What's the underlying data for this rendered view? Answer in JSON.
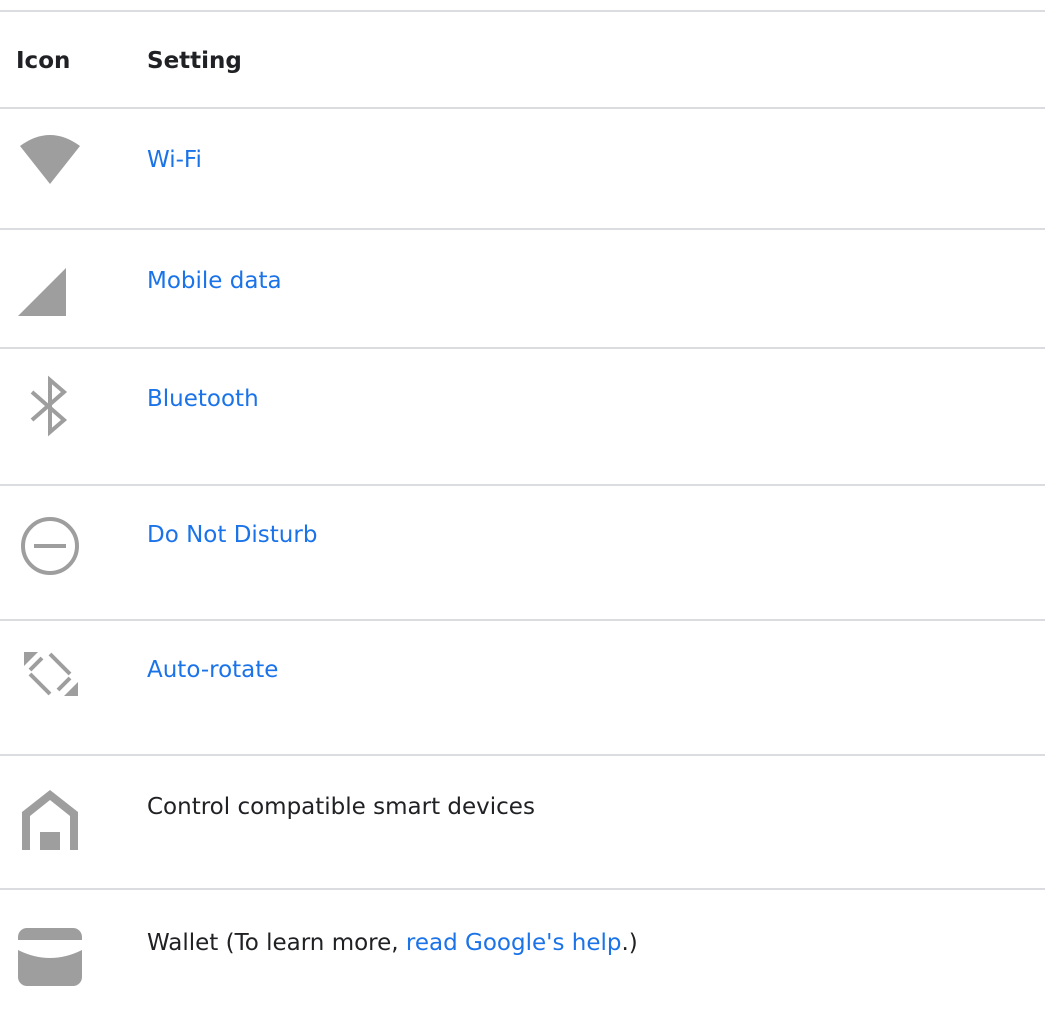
{
  "header": {
    "icon_col": "Icon",
    "setting_col": "Setting"
  },
  "colors": {
    "link": "#1a73e8",
    "text": "#202124",
    "icon": "#9e9e9e",
    "rule": "#dadce0"
  },
  "rows": [
    {
      "icon": "wifi-icon",
      "label": "Wi-Fi",
      "is_link": true
    },
    {
      "icon": "mobile-signal-icon",
      "label": "Mobile data",
      "is_link": true
    },
    {
      "icon": "bluetooth-icon",
      "label": "Bluetooth",
      "is_link": true
    },
    {
      "icon": "do-not-disturb-icon",
      "label": "Do Not Disturb",
      "is_link": true
    },
    {
      "icon": "auto-rotate-icon",
      "label": "Auto-rotate",
      "is_link": true
    },
    {
      "icon": "home-icon",
      "label": "Control compatible smart devices",
      "is_link": false
    },
    {
      "icon": "wallet-icon",
      "label_before": "Wallet (To learn more, ",
      "link_text": "read Google's help",
      "label_after": ".)"
    }
  ]
}
